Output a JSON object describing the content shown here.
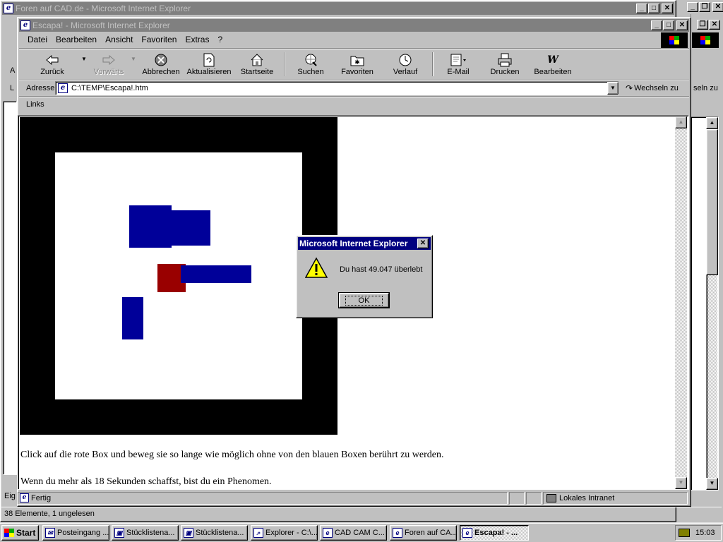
{
  "back_window": {
    "title": "Foren auf CAD.de - Microsoft Internet Explorer",
    "go_label": "seln zu",
    "status": "38 Elemente, 1 ungelesen",
    "left_letters": [
      "A",
      "L",
      "Eig"
    ]
  },
  "window": {
    "title": "Escapa! - Microsoft Internet Explorer",
    "menu": [
      "Datei",
      "Bearbeiten",
      "Ansicht",
      "Favoriten",
      "Extras",
      "?"
    ],
    "toolbar": [
      {
        "label": "Zurück",
        "icon": "back-arrow-icon"
      },
      {
        "label": "Vorwärts",
        "icon": "forward-arrow-icon"
      },
      {
        "label": "Abbrechen",
        "icon": "stop-icon"
      },
      {
        "label": "Aktualisieren",
        "icon": "refresh-icon"
      },
      {
        "label": "Startseite",
        "icon": "home-icon"
      },
      {
        "label": "Suchen",
        "icon": "search-icon"
      },
      {
        "label": "Favoriten",
        "icon": "favorites-icon"
      },
      {
        "label": "Verlauf",
        "icon": "history-icon"
      },
      {
        "label": "E-Mail",
        "icon": "mail-icon"
      },
      {
        "label": "Drucken",
        "icon": "print-icon"
      },
      {
        "label": "Bearbeiten",
        "icon": "edit-icon"
      }
    ],
    "address_label": "Adresse",
    "address_value": "C:\\TEMP\\Escapa!.htm",
    "go_label": "Wechseln zu",
    "links_label": "Links",
    "status_text": "Fertig",
    "zone_text": "Lokales Intranet"
  },
  "page": {
    "line1": "Click auf die rote Box und beweg sie so lange wie möglich ohne von den blauen Boxen berührt zu werden.",
    "line2": "Wenn du mehr als 18 Sekunden schaffst, bist du ein Phenomen.",
    "colors": {
      "border": "#000000",
      "field": "#ffffff",
      "blue": "#000099",
      "red": "#990000"
    }
  },
  "dialog": {
    "title": "Microsoft Internet Explorer",
    "message": "Du hast 49.047 überlebt",
    "ok_label": "OK",
    "icon": "warning-icon"
  },
  "taskbar": {
    "start_label": "Start",
    "tasks": [
      {
        "label": "Posteingang ..."
      },
      {
        "label": "Stücklistena..."
      },
      {
        "label": "Stücklistena..."
      },
      {
        "label": "Explorer - C:\\..."
      },
      {
        "label": "CAD CAM C..."
      },
      {
        "label": "Foren auf CA..."
      },
      {
        "label": "Escapa! - ..."
      }
    ],
    "clock": "15:03"
  }
}
